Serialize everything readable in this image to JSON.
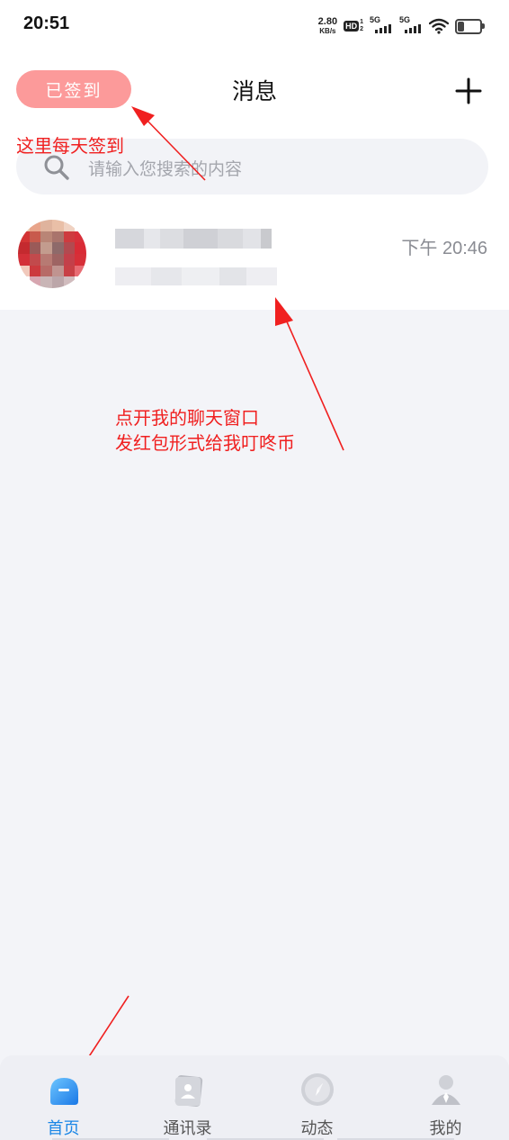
{
  "status_bar": {
    "time": "20:51",
    "net_speed_value": "2.80",
    "net_speed_unit": "KB/s",
    "hd_label": "HD",
    "hd_sub1": "1",
    "hd_sub2": "2",
    "sim1_label": "5G",
    "sim2_label": "5G",
    "battery_level": 0.3
  },
  "header": {
    "checkin_label": "已签到",
    "title": "消息",
    "add_icon": "plus-icon"
  },
  "search": {
    "placeholder": "请输入您搜索的内容",
    "icon": "search-icon"
  },
  "conversations": [
    {
      "name": "",
      "preview": "",
      "time": "下午 20:46",
      "avatar_blurred": true
    }
  ],
  "annotations": {
    "checkin_note": "这里每天签到",
    "chat_note_line1": "点开我的聊天窗口",
    "chat_note_line2": "发红包形式给我叮咚币"
  },
  "tab_bar": {
    "tabs": [
      {
        "label": "首页",
        "icon": "home-icon",
        "active": true
      },
      {
        "label": "通讯录",
        "icon": "contacts-icon",
        "active": false
      },
      {
        "label": "动态",
        "icon": "compass-icon",
        "active": false
      },
      {
        "label": "我的",
        "icon": "profile-icon",
        "active": false
      }
    ]
  },
  "colors": {
    "checkin_bg": "#fc9a9a",
    "accent_blue": "#1a86e6",
    "annotation_red": "#f02020",
    "page_bg": "#f3f4f8"
  }
}
